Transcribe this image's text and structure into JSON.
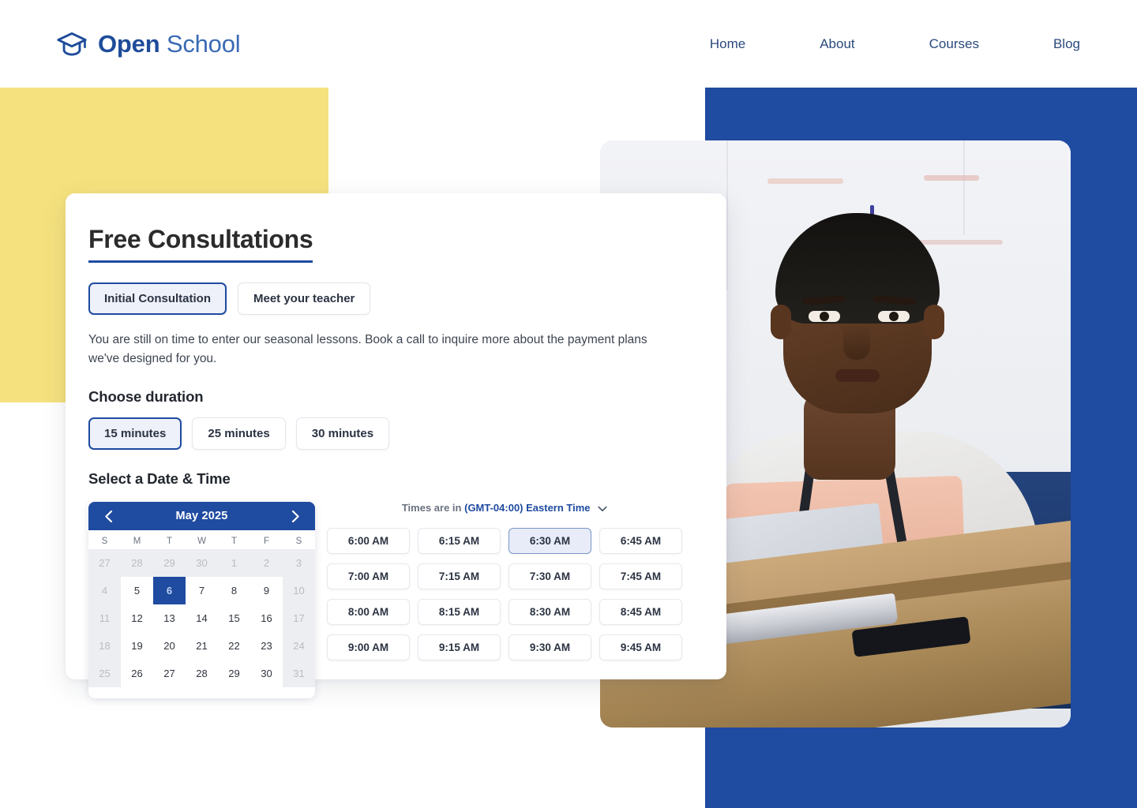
{
  "header": {
    "logo_icon": "graduation-cap-icon",
    "brand_bold": "Open",
    "brand_light": "School",
    "nav": [
      {
        "label": "Home"
      },
      {
        "label": "About"
      },
      {
        "label": "Courses"
      },
      {
        "label": "Blog"
      }
    ]
  },
  "card": {
    "title": "Free Consultations",
    "tabs": [
      {
        "label": "Initial Consultation",
        "selected": true
      },
      {
        "label": "Meet your teacher",
        "selected": false
      }
    ],
    "description": "You are still on time to enter our seasonal lessons. Book a call to inquire more about the payment plans we've designed for you.",
    "duration_heading": "Choose duration",
    "durations": [
      {
        "label": "15 minutes",
        "selected": true
      },
      {
        "label": "25 minutes",
        "selected": false
      },
      {
        "label": "30 minutes",
        "selected": false
      }
    ],
    "datetime_heading": "Select a Date & Time"
  },
  "calendar": {
    "prev_icon": "chevron-left-icon",
    "next_icon": "chevron-right-icon",
    "month_label": "May 2025",
    "weekdays": [
      "S",
      "M",
      "T",
      "W",
      "T",
      "F",
      "S"
    ],
    "selected_day": 6,
    "weeks": [
      [
        {
          "n": "27",
          "state": "muted"
        },
        {
          "n": "28",
          "state": "muted"
        },
        {
          "n": "29",
          "state": "muted"
        },
        {
          "n": "30",
          "state": "muted"
        },
        {
          "n": "1",
          "state": "muted"
        },
        {
          "n": "2",
          "state": "muted"
        },
        {
          "n": "3",
          "state": "muted"
        }
      ],
      [
        {
          "n": "4",
          "state": "weekend"
        },
        {
          "n": "5",
          "state": "normal"
        },
        {
          "n": "6",
          "state": "sel"
        },
        {
          "n": "7",
          "state": "normal"
        },
        {
          "n": "8",
          "state": "normal"
        },
        {
          "n": "9",
          "state": "normal"
        },
        {
          "n": "10",
          "state": "weekend"
        }
      ],
      [
        {
          "n": "11",
          "state": "weekend"
        },
        {
          "n": "12",
          "state": "normal"
        },
        {
          "n": "13",
          "state": "normal"
        },
        {
          "n": "14",
          "state": "normal"
        },
        {
          "n": "15",
          "state": "normal"
        },
        {
          "n": "16",
          "state": "normal"
        },
        {
          "n": "17",
          "state": "weekend"
        }
      ],
      [
        {
          "n": "18",
          "state": "weekend"
        },
        {
          "n": "19",
          "state": "normal"
        },
        {
          "n": "20",
          "state": "normal"
        },
        {
          "n": "21",
          "state": "normal"
        },
        {
          "n": "22",
          "state": "normal"
        },
        {
          "n": "23",
          "state": "normal"
        },
        {
          "n": "24",
          "state": "weekend"
        }
      ],
      [
        {
          "n": "25",
          "state": "weekend"
        },
        {
          "n": "26",
          "state": "normal"
        },
        {
          "n": "27",
          "state": "normal"
        },
        {
          "n": "28",
          "state": "normal"
        },
        {
          "n": "29",
          "state": "normal"
        },
        {
          "n": "30",
          "state": "normal"
        },
        {
          "n": "31",
          "state": "weekend"
        }
      ]
    ]
  },
  "timezone": {
    "prefix": "Times are in",
    "value": "(GMT-04:00) Eastern Time",
    "dropdown_icon": "chevron-down-icon"
  },
  "time_slots": [
    {
      "label": "6:00 AM",
      "selected": false
    },
    {
      "label": "6:15 AM",
      "selected": false
    },
    {
      "label": "6:30 AM",
      "selected": true
    },
    {
      "label": "6:45 AM",
      "selected": false
    },
    {
      "label": "7:00 AM",
      "selected": false
    },
    {
      "label": "7:15 AM",
      "selected": false
    },
    {
      "label": "7:30 AM",
      "selected": false
    },
    {
      "label": "7:45 AM",
      "selected": false
    },
    {
      "label": "8:00 AM",
      "selected": false
    },
    {
      "label": "8:15 AM",
      "selected": false
    },
    {
      "label": "8:30 AM",
      "selected": false
    },
    {
      "label": "8:45 AM",
      "selected": false
    },
    {
      "label": "9:00 AM",
      "selected": false
    },
    {
      "label": "9:15 AM",
      "selected": false
    },
    {
      "label": "9:30 AM",
      "selected": false
    },
    {
      "label": "9:45 AM",
      "selected": false
    }
  ],
  "decor": {
    "yellow_blob_color": "#f5e27e",
    "blue_panel_color": "#1f4ba0",
    "accent_color": "#1f4ba0",
    "photo_alt": "student-at-laptop-photo"
  }
}
